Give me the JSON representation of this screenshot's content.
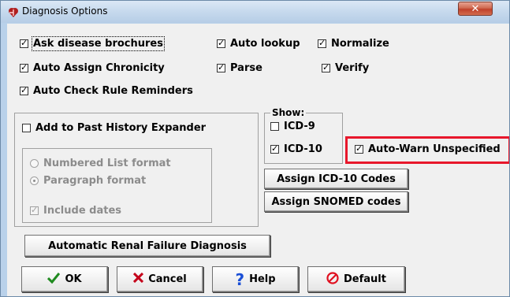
{
  "window": {
    "title": "Diagnosis Options",
    "close_glyph": "✕"
  },
  "options": {
    "ask_disease_brochures": {
      "label": "Ask disease brochures",
      "checked": true
    },
    "auto_lookup": {
      "label": "Auto lookup",
      "checked": true
    },
    "normalize": {
      "label": "Normalize",
      "checked": true
    },
    "auto_assign_chronicity": {
      "label": "Auto Assign Chronicity",
      "checked": true
    },
    "parse": {
      "label": "Parse",
      "checked": true
    },
    "verify": {
      "label": "Verify",
      "checked": true
    },
    "auto_check_rule_reminders": {
      "label": "Auto Check Rule Reminders",
      "checked": true
    }
  },
  "past_history": {
    "add_to_expander": {
      "label": "Add to Past History Expander",
      "checked": false
    },
    "numbered_list": {
      "label": "Numbered List format",
      "selected": false
    },
    "paragraph": {
      "label": "Paragraph format",
      "selected": true
    },
    "include_dates": {
      "label": "Include dates",
      "checked": true
    }
  },
  "show": {
    "title": "Show:",
    "icd9": {
      "label": "ICD-9",
      "checked": false
    },
    "icd10": {
      "label": "ICD-10",
      "checked": true
    },
    "auto_warn_unspecified": {
      "label": "Auto-Warn Unspecified",
      "checked": true
    }
  },
  "buttons": {
    "assign_icd10": "Assign ICD-10 Codes",
    "assign_snomed": "Assign SNOMED codes",
    "renal": "Automatic Renal Failure Diagnosis",
    "ok": "OK",
    "cancel": "Cancel",
    "help": "Help",
    "default": "Default"
  },
  "colors": {
    "highlight": "#e8172b",
    "ok_check": "#1f8a1f",
    "cancel_x": "#c4001a",
    "help_q": "#1a4fd6",
    "default_icon": "#e01020"
  }
}
